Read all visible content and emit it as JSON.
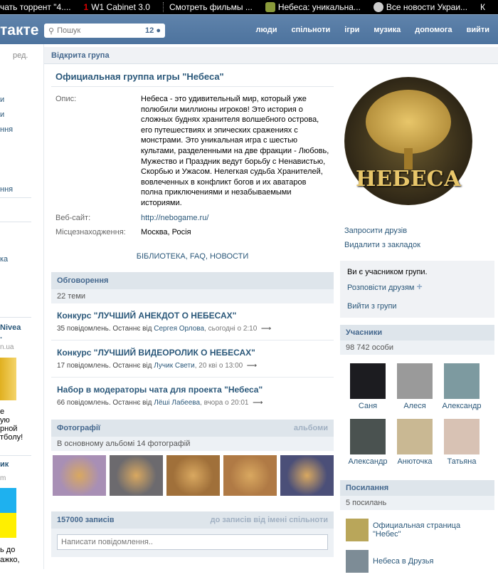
{
  "browser_tabs": [
    {
      "label": "чать торрент \"4....",
      "icon": "none"
    },
    {
      "label": "W1 Cabinet 3.0",
      "icon": "red-1-icon"
    },
    {
      "label": "Смотреть фильмы ...",
      "icon": "none"
    },
    {
      "label": "Небеса: уникальна...",
      "icon": "tree-icon"
    },
    {
      "label": "Все новости Украи...",
      "icon": "news-icon"
    },
    {
      "label": "К",
      "icon": "none"
    }
  ],
  "header": {
    "logo": "такте",
    "search_placeholder": "Пошук",
    "search_count": "12",
    "nav": [
      "люди",
      "спільноти",
      "ігри",
      "музика",
      "допомога",
      "вийти"
    ]
  },
  "left_fragments": [
    "ред.",
    "и",
    "и",
    "ння",
    "ння",
    "ка",
    "Nivea",
    ".",
    "n.ua",
    "е",
    "ую",
    "рной",
    "тболу!",
    "ик",
    "m",
    "ь до",
    "ажко,"
  ],
  "group": {
    "type_label": "Відкрита група",
    "title": "Официальная группа игры \"Небеса\"",
    "info": [
      {
        "key": "Опис:",
        "value": "Небеса - это удивительный мир, который уже полюбили миллионы игроков! Это история о сложных буднях хранителя волшебного острова, его путешествиях и эпических сражениях с монстрами. Это уникальная игра с шестью культами, разделенными на две фракции - Любовь, Мужество и Праздник ведут борьбу с Ненавистью, Скорбью и Ужасом. Нелегкая судьба Хранителей, вовлеченных в конфликт богов и их аватаров полна приключениями и незабываемыми историями."
      },
      {
        "key": "Веб-сайт:",
        "value": "http://nebogame.ru/"
      },
      {
        "key": "Місцезнаходження:",
        "value": "Москва, Росія"
      }
    ],
    "links_line": "БІБЛИОТЕКА, FAQ, НОВОСТИ"
  },
  "discussions": {
    "title": "Обговорення",
    "count": "22 теми",
    "topics": [
      {
        "title": "Конкурс \"ЛУЧШИЙ АНЕКДОТ О НЕБЕСАХ\"",
        "meta": "35 повідомлень. Останнє від ",
        "author": "Сергея Орлова",
        "time": ", сьогодні о 2:10",
        "arrow": "⟶"
      },
      {
        "title": "Конкурс \"ЛУЧШИЙ ВИДЕОРОЛИК О НЕБЕСАХ\"",
        "meta": "17 повідомлень. Останнє від ",
        "author": "Лучик Свети",
        "time": ", 20 кві о 13:00",
        "arrow": "⟶"
      },
      {
        "title": "Набор в модераторы чата для проекта \"Небеса\"",
        "meta": "66 повідомлень. Останнє від ",
        "author": "Лёші Лабеева",
        "time": ", вчора о 20:01",
        "arrow": "⟶"
      }
    ]
  },
  "photos": {
    "title": "Фотографії",
    "albums_link": "альбоми",
    "subtitle": "В основному альбомі 14 фотографій",
    "colors": [
      "#a88fb5",
      "#6c6a6e",
      "#a0703a",
      "#b07a45",
      "#4b4f78"
    ]
  },
  "wall": {
    "title": "157000 записів",
    "link": "до записів від імені спільноти",
    "placeholder": "Написати повідомлення.."
  },
  "right": {
    "logo_text": "НЕБЕСА",
    "actions": [
      "Запросити друзів",
      "Видалити з закладок"
    ],
    "member_status": "Ви є учасником групи.",
    "share": "Розповісти друзям",
    "leave": "Вийти з групи",
    "members_title": "Учасники",
    "members_count": "98 742 особи",
    "members": [
      {
        "name": "Саня",
        "color": "#1c1c20"
      },
      {
        "name": "Алеся",
        "color": "#9a9a9a"
      },
      {
        "name": "Александр",
        "color": "#7d9aa0"
      },
      {
        "name": "Александр",
        "color": "#4a5250"
      },
      {
        "name": "Анюточка",
        "color": "#c9b893"
      },
      {
        "name": "Татьяна",
        "color": "#d8c2b4"
      }
    ],
    "links_title": "Посилання",
    "links_count": "5 посилань",
    "links": [
      {
        "label": "Официальная страница \"Небес\"",
        "color": "#b9a65a"
      },
      {
        "label": "Небеса в Друзья",
        "color": "#7d8c96"
      }
    ]
  }
}
